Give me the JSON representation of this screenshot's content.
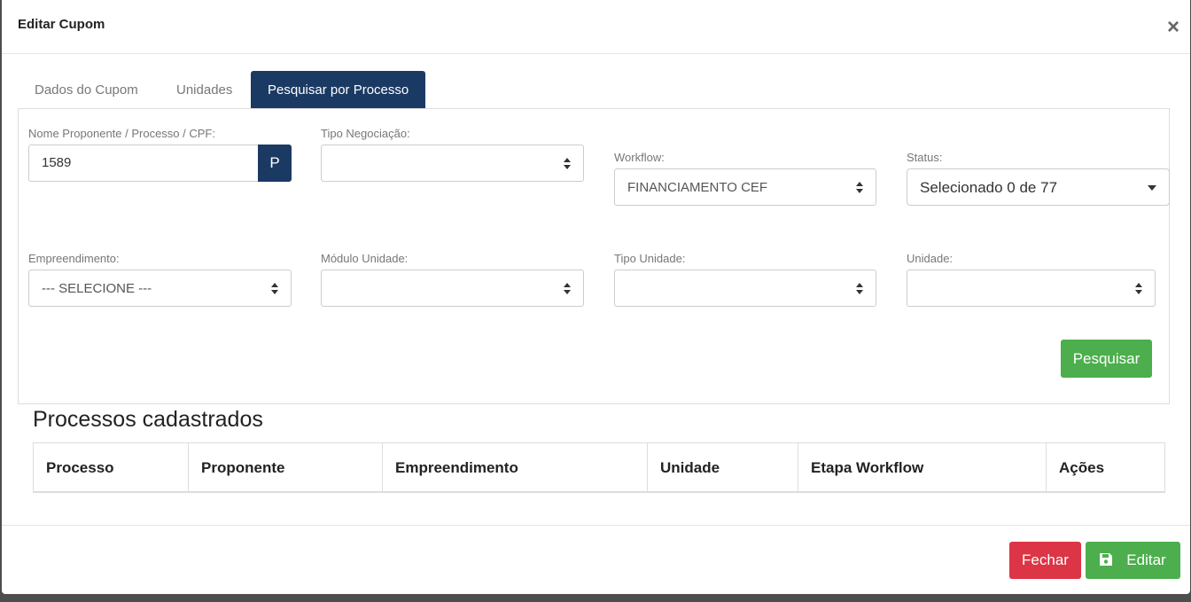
{
  "modal": {
    "title": "Editar Cupom",
    "close": "×"
  },
  "tabs": [
    {
      "label": "Dados do Cupom",
      "active": false
    },
    {
      "label": "Unidades",
      "active": false
    },
    {
      "label": "Pesquisar por Processo",
      "active": true
    }
  ],
  "filters": {
    "search": {
      "label": "Nome Proponente / Processo / CPF:",
      "value": "1589",
      "button": "P"
    },
    "tipo_negociacao": {
      "label": "Tipo Negociação:",
      "value": ""
    },
    "workflow": {
      "label": "Workflow:",
      "value": "FINANCIAMENTO CEF"
    },
    "status": {
      "label": "Status:",
      "value": "Selecionado 0 de 77"
    },
    "empreendimento": {
      "label": "Empreendimento:",
      "value": "--- SELECIONE ---"
    },
    "modulo_unidade": {
      "label": "Módulo Unidade:",
      "value": ""
    },
    "tipo_unidade": {
      "label": "Tipo Unidade:",
      "value": ""
    },
    "unidade": {
      "label": "Unidade:",
      "value": ""
    },
    "search_button": "Pesquisar"
  },
  "results": {
    "title": "Processos cadastrados",
    "columns": [
      "Processo",
      "Proponente",
      "Empreendimento",
      "Unidade",
      "Etapa Workflow",
      "Ações"
    ]
  },
  "footer": {
    "close_label": "Fechar",
    "edit_label": "Editar",
    "edit_icon": "save-icon"
  },
  "colors": {
    "primary": "#1b3a63",
    "success": "#4cae4c",
    "danger": "#dc3545"
  }
}
